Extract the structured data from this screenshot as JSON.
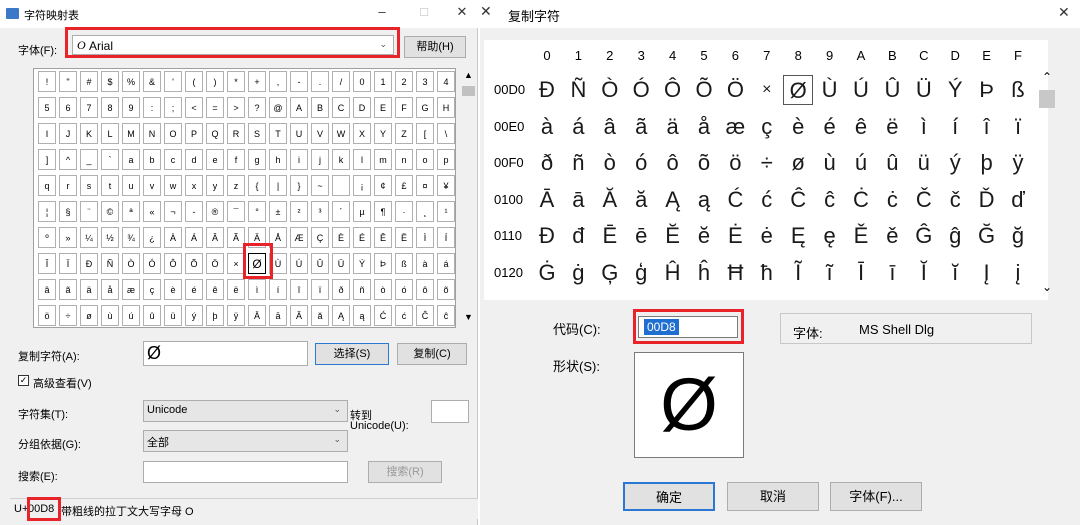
{
  "left": {
    "title": "字符映射表",
    "font_label": "字体(F):",
    "font_value": "Arial",
    "font_icon": "O",
    "help_button": "帮助(H)",
    "grid": [
      [
        "!",
        "\"",
        "#",
        "$",
        "%",
        "&",
        "'",
        "(",
        ")",
        "*",
        "+",
        ",",
        "-",
        ".",
        "/",
        "0",
        "1",
        "2",
        "3",
        "4"
      ],
      [
        "5",
        "6",
        "7",
        "8",
        "9",
        ":",
        ";",
        "<",
        "=",
        ">",
        "?",
        "@",
        "A",
        "B",
        "C",
        "D",
        "E",
        "F",
        "G",
        "H"
      ],
      [
        "I",
        "J",
        "K",
        "L",
        "M",
        "N",
        "O",
        "P",
        "Q",
        "R",
        "S",
        "T",
        "U",
        "V",
        "W",
        "X",
        "Y",
        "Z",
        "[",
        "\\"
      ],
      [
        "]",
        "^",
        "_",
        "`",
        "a",
        "b",
        "c",
        "d",
        "e",
        "f",
        "g",
        "h",
        "i",
        "j",
        "k",
        "l",
        "m",
        "n",
        "o",
        "p"
      ],
      [
        "q",
        "r",
        "s",
        "t",
        "u",
        "v",
        "w",
        "x",
        "y",
        "z",
        "{",
        "|",
        "}",
        "~",
        " ",
        "¡",
        "¢",
        "£",
        "¤",
        "¥"
      ],
      [
        "¦",
        "§",
        "¨",
        "©",
        "ª",
        "«",
        "¬",
        "-",
        "®",
        "¯",
        "°",
        "±",
        "²",
        "³",
        "´",
        "µ",
        "¶",
        "·",
        "¸",
        "¹"
      ],
      [
        "º",
        "»",
        "¼",
        "½",
        "¾",
        "¿",
        "À",
        "Á",
        "Â",
        "Ã",
        "Ä",
        "Å",
        "Æ",
        "Ç",
        "È",
        "É",
        "Ê",
        "Ë",
        "Ì",
        "Í"
      ],
      [
        "Î",
        "Ï",
        "Ð",
        "Ñ",
        "Ò",
        "Ó",
        "Ô",
        "Õ",
        "Ö",
        "×",
        "Ø",
        "Ù",
        "Ú",
        "Û",
        "Ü",
        "Ý",
        "Þ",
        "ß",
        "à",
        "á"
      ],
      [
        "â",
        "ã",
        "ä",
        "å",
        "æ",
        "ç",
        "è",
        "é",
        "ê",
        "ë",
        "ì",
        "í",
        "î",
        "ï",
        "ð",
        "ñ",
        "ò",
        "ó",
        "ô",
        "õ"
      ],
      [
        "ö",
        "÷",
        "ø",
        "ù",
        "ú",
        "û",
        "ü",
        "ý",
        "þ",
        "ÿ",
        "Ā",
        "ā",
        "Ă",
        "ă",
        "Ą",
        "ą",
        "Ć",
        "ć",
        "Ĉ",
        "ĉ"
      ]
    ],
    "copy_label": "复制字符(A):",
    "copy_value": "Ø",
    "select_button": "选择(S)",
    "copy_button": "复制(C)",
    "advanced_label": "高级查看(V)",
    "charset_label": "字符集(T):",
    "charset_value": "Unicode",
    "goto_label": "转到",
    "goto_label2": "Unicode(U):",
    "group_label": "分组依据(G):",
    "group_value": "全部",
    "search_label": "搜索(E):",
    "search_button": "搜索(R)",
    "status_prefix": "U+",
    "status_code": "00D8",
    "status_desc": "带粗线的拉丁文大写字母 O"
  },
  "right": {
    "title": "复制字符",
    "columns": [
      "0",
      "1",
      "2",
      "3",
      "4",
      "5",
      "6",
      "7",
      "8",
      "9",
      "A",
      "B",
      "C",
      "D",
      "E",
      "F"
    ],
    "rows": [
      {
        "label": "00D0",
        "chars": [
          "Ð",
          "Ñ",
          "Ò",
          "Ó",
          "Ô",
          "Õ",
          "Ö",
          "×",
          "Ø",
          "Ù",
          "Ú",
          "Û",
          "Ü",
          "Ý",
          "Þ",
          "ß"
        ]
      },
      {
        "label": "00E0",
        "chars": [
          "à",
          "á",
          "â",
          "ã",
          "ä",
          "å",
          "æ",
          "ç",
          "è",
          "é",
          "ê",
          "ë",
          "ì",
          "í",
          "î",
          "ï"
        ]
      },
      {
        "label": "00F0",
        "chars": [
          "ð",
          "ñ",
          "ò",
          "ó",
          "ô",
          "õ",
          "ö",
          "÷",
          "ø",
          "ù",
          "ú",
          "û",
          "ü",
          "ý",
          "þ",
          "ÿ"
        ]
      },
      {
        "label": "0100",
        "chars": [
          "Ā",
          "ā",
          "Ă",
          "ă",
          "Ą",
          "ą",
          "Ć",
          "ć",
          "Ĉ",
          "ĉ",
          "Ċ",
          "ċ",
          "Č",
          "č",
          "Ď",
          "ď"
        ]
      },
      {
        "label": "0110",
        "chars": [
          "Đ",
          "đ",
          "Ē",
          "ē",
          "Ĕ",
          "ĕ",
          "Ė",
          "ė",
          "Ę",
          "ę",
          "Ě",
          "ě",
          "Ĝ",
          "ĝ",
          "Ğ",
          "ğ"
        ]
      },
      {
        "label": "0120",
        "chars": [
          "Ġ",
          "ġ",
          "Ģ",
          "ģ",
          "Ĥ",
          "ĥ",
          "Ħ",
          "ħ",
          "Ĩ",
          "ĩ",
          "Ī",
          "ī",
          "Ĭ",
          "ĭ",
          "Į",
          "į"
        ]
      }
    ],
    "code_label": "代码(C):",
    "code_value": "00D8",
    "font_label": "字体:",
    "font_value": "MS Shell Dlg",
    "shape_label": "形状(S):",
    "shape_char": "Ø",
    "ok_button": "确定",
    "cancel_button": "取消",
    "font_button": "字体(F)..."
  }
}
